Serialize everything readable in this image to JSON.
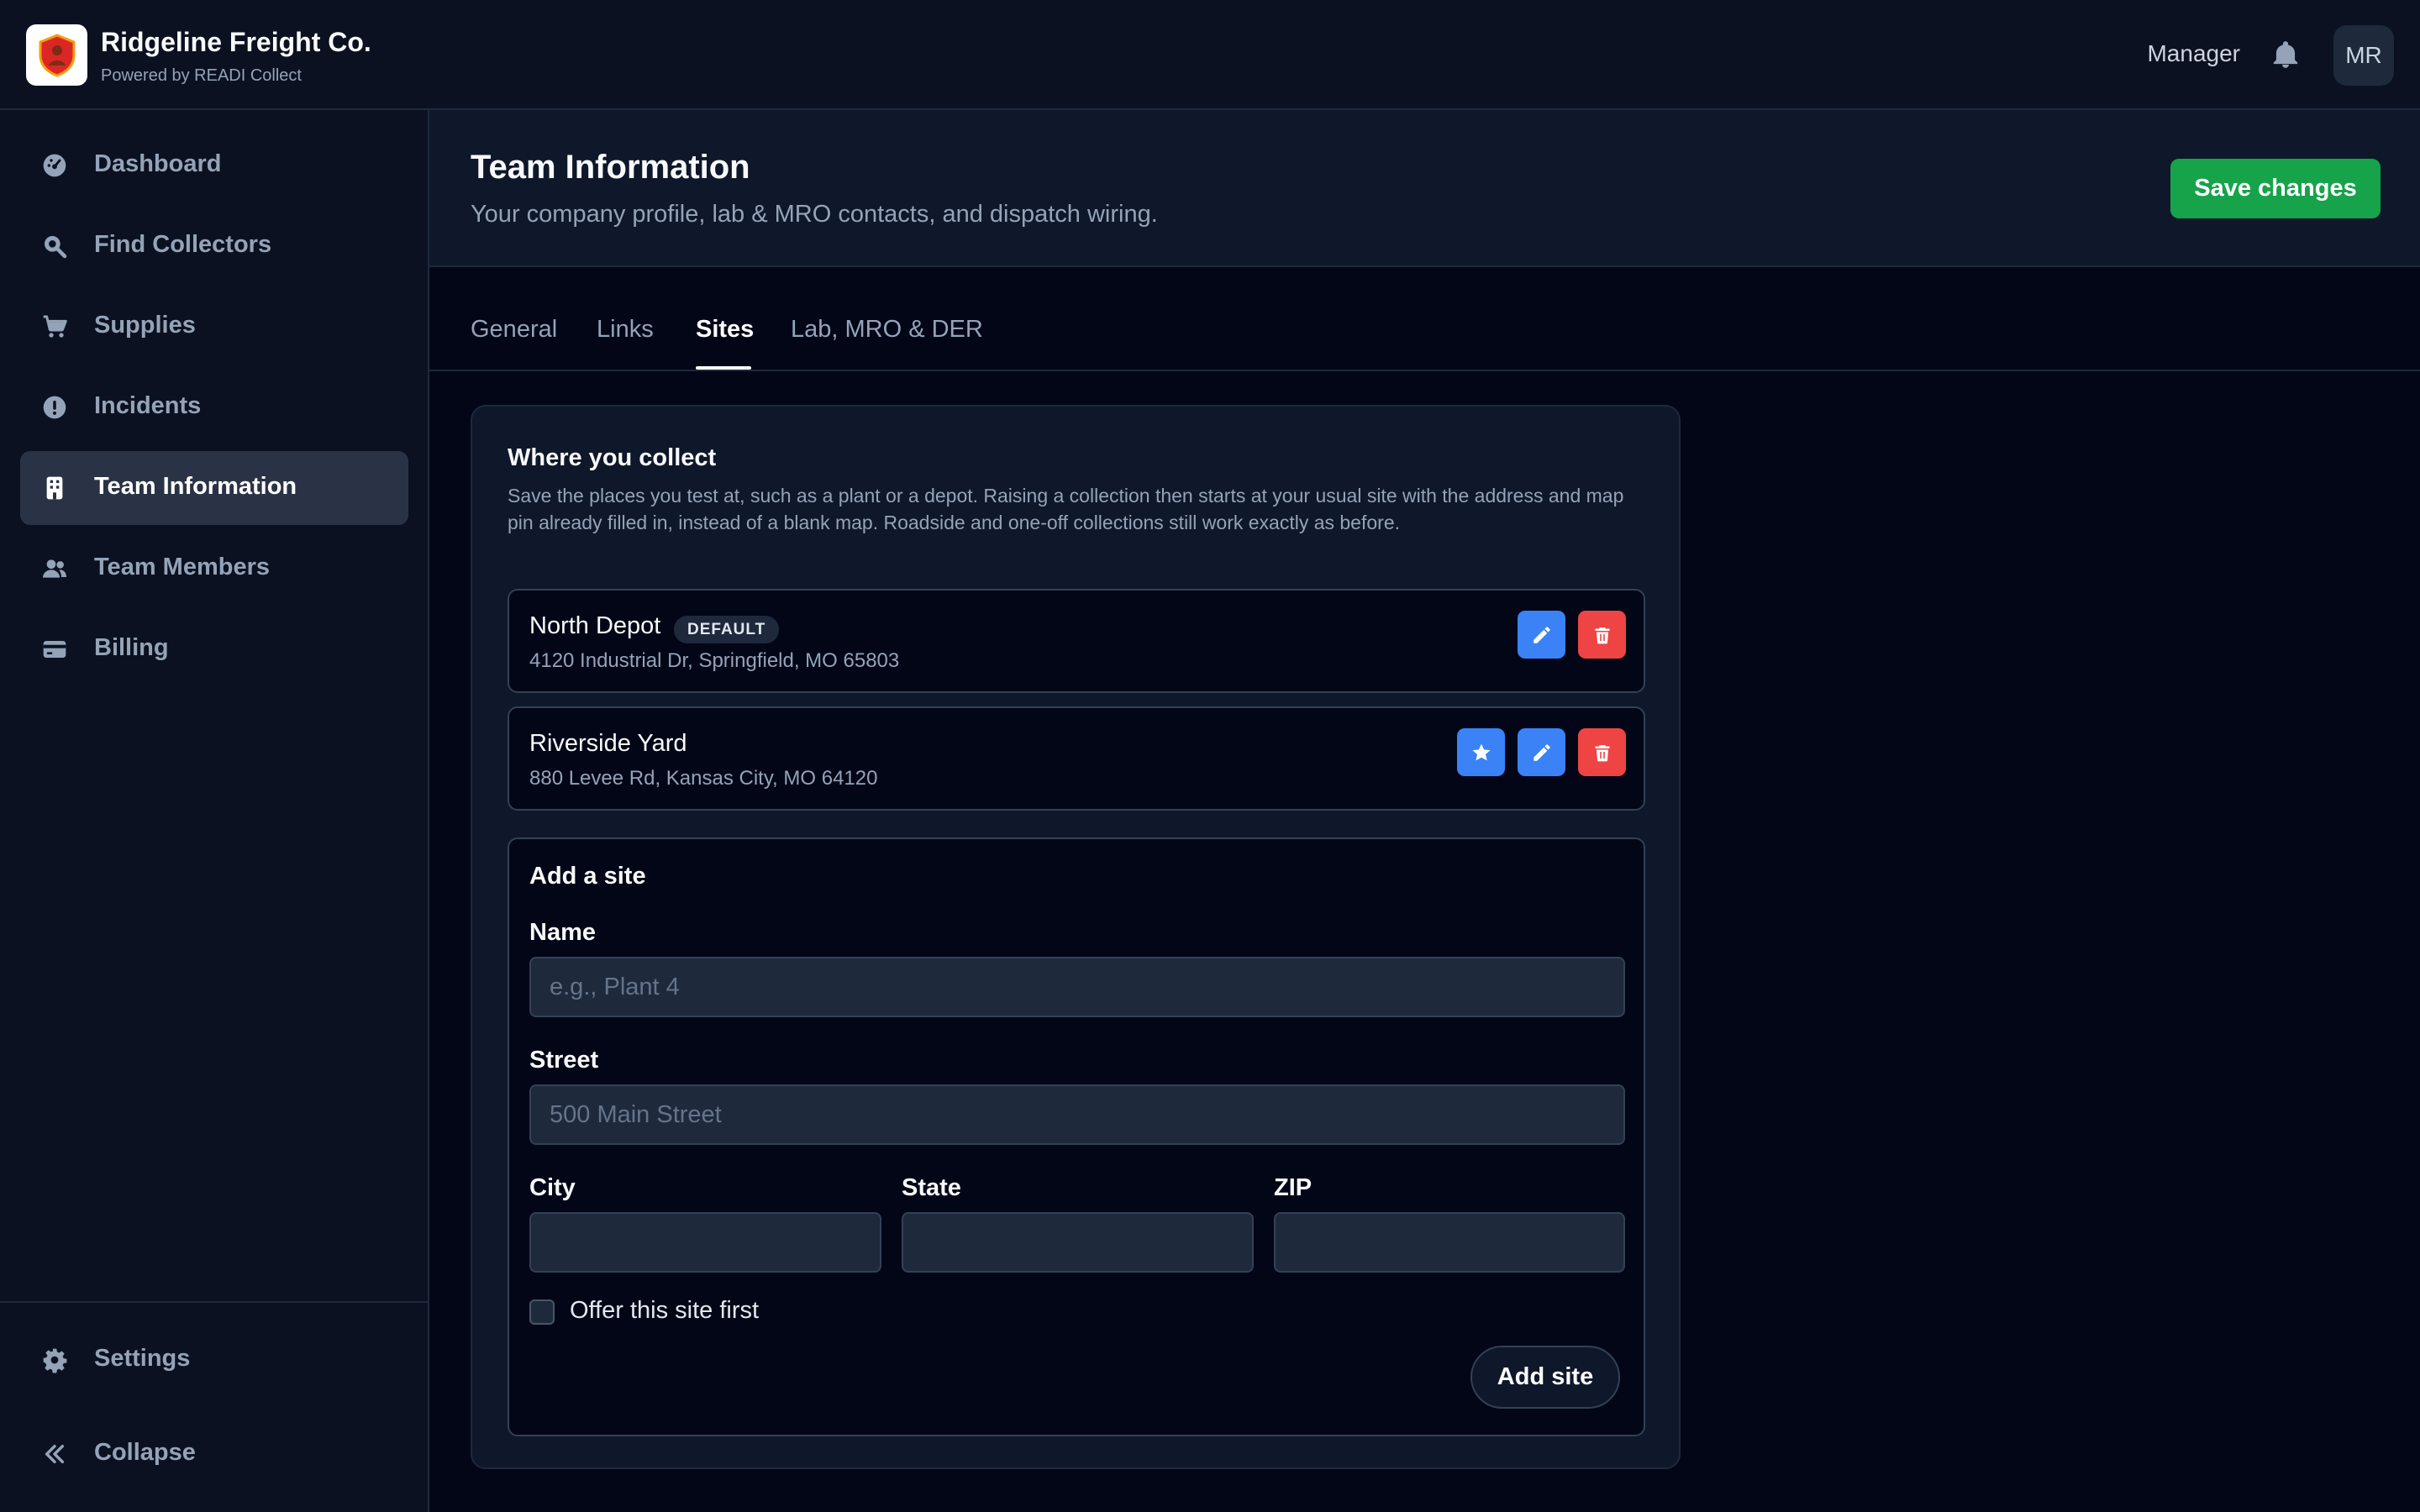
{
  "app": {
    "name": "Ridgeline Freight Co.",
    "powered_by": "Powered by READI Collect",
    "role": "Manager",
    "avatar_initials": "MR",
    "accent_color": "#16a34a"
  },
  "sidebar": {
    "items": [
      {
        "label": "Dashboard",
        "icon": "dashboard-gauge-icon"
      },
      {
        "label": "Find Collectors",
        "icon": "search-icon"
      },
      {
        "label": "Supplies",
        "icon": "cart-icon"
      },
      {
        "label": "Incidents",
        "icon": "alert-icon"
      },
      {
        "label": "Team Information",
        "icon": "building-icon",
        "active": true
      },
      {
        "label": "Team Members",
        "icon": "users-icon"
      },
      {
        "label": "Billing",
        "icon": "credit-card-icon"
      }
    ],
    "footer": [
      {
        "label": "Settings",
        "icon": "gear-icon"
      },
      {
        "label": "Collapse",
        "icon": "chevrons-left-icon"
      }
    ]
  },
  "page": {
    "title": "Team Information",
    "subtitle": "Your company profile, lab & MRO contacts, and dispatch wiring.",
    "save_label": "Save changes"
  },
  "tabs": [
    {
      "label": "General"
    },
    {
      "label": "Links"
    },
    {
      "label": "Sites",
      "active": true
    },
    {
      "label": "Lab, MRO & DER"
    }
  ],
  "sites_card": {
    "title": "Where you collect",
    "description": "Save the places you test at, such as a plant or a depot. Raising a collection then starts at your usual site with the address and map pin already filled in, instead of a blank map. Roadside and one-off collections still work exactly as before.",
    "sites": [
      {
        "name": "North Depot",
        "badge": "DEFAULT",
        "address": "4120 Industrial Dr, Springfield, MO 65803"
      },
      {
        "name": "Riverside Yard",
        "address": "880 Levee Rd, Kansas City, MO 64120"
      }
    ]
  },
  "add_site": {
    "title": "Add a site",
    "name_label": "Name",
    "name_placeholder": "e.g., Plant 4",
    "street_label": "Street",
    "street_placeholder": "500 Main Street",
    "city_label": "City",
    "state_label": "State",
    "zip_label": "ZIP",
    "default_checkbox_label": "Offer this site first",
    "submit_label": "Add site"
  }
}
